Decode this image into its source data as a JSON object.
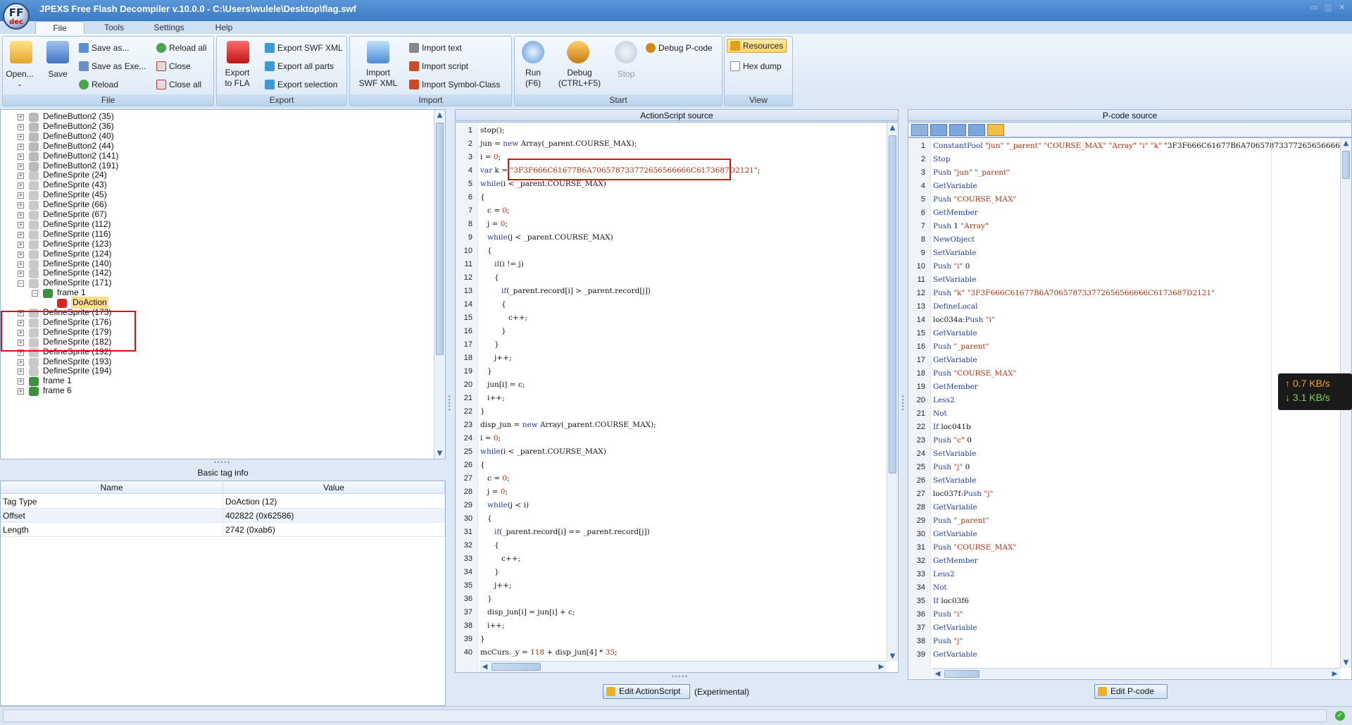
{
  "window": {
    "title": "JPEXS Free Flash Decompiler v.10.0.0 - C:\\Users\\wulele\\Desktop\\flag.swf",
    "logo_text": "FF",
    "logo_sub": "dec"
  },
  "menu": {
    "tabs": [
      "File",
      "Tools",
      "Settings",
      "Help"
    ],
    "active": "File"
  },
  "ribbon": {
    "file": {
      "title": "File",
      "open": "Open...",
      "save": "Save",
      "save_as": "Save as...",
      "save_as_exe": "Save as Exe...",
      "reload": "Reload",
      "reload_all": "Reload all",
      "close": "Close",
      "close_all": "Close all"
    },
    "export": {
      "title": "Export",
      "export_fla_l1": "Export",
      "export_fla_l2": "to FLA",
      "export_swf_xml": "Export SWF XML",
      "export_all_parts": "Export all parts",
      "export_selection": "Export selection"
    },
    "import": {
      "title": "Import",
      "import_swf_xml_l1": "Import",
      "import_swf_xml_l2": "SWF XML",
      "import_text": "Import text",
      "import_script": "Import script",
      "import_symbol_class": "Import Symbol-Class"
    },
    "start": {
      "title": "Start",
      "run_l1": "Run",
      "run_l2": "(F6)",
      "debug_l1": "Debug",
      "debug_l2": "(CTRL+F5)",
      "stop": "Stop",
      "debug_pcode": "Debug P-code"
    },
    "view": {
      "title": "View",
      "resources": "Resources",
      "hex_dump": "Hex dump"
    }
  },
  "tree": {
    "items": [
      {
        "label": "DefineButton2 (35)",
        "type": "button",
        "depth": 0
      },
      {
        "label": "DefineButton2 (36)",
        "type": "button",
        "depth": 0
      },
      {
        "label": "DefineButton2 (40)",
        "type": "button",
        "depth": 0
      },
      {
        "label": "DefineButton2 (44)",
        "type": "button",
        "depth": 0
      },
      {
        "label": "DefineButton2 (141)",
        "type": "button",
        "depth": 0
      },
      {
        "label": "DefineButton2 (191)",
        "type": "button",
        "depth": 0
      },
      {
        "label": "DefineSprite (24)",
        "type": "sprite",
        "depth": 0
      },
      {
        "label": "DefineSprite (43)",
        "type": "sprite",
        "depth": 0
      },
      {
        "label": "DefineSprite (45)",
        "type": "sprite",
        "depth": 0
      },
      {
        "label": "DefineSprite (66)",
        "type": "sprite",
        "depth": 0
      },
      {
        "label": "DefineSprite (67)",
        "type": "sprite",
        "depth": 0
      },
      {
        "label": "DefineSprite (112)",
        "type": "sprite",
        "depth": 0
      },
      {
        "label": "DefineSprite (116)",
        "type": "sprite",
        "depth": 0
      },
      {
        "label": "DefineSprite (123)",
        "type": "sprite",
        "depth": 0
      },
      {
        "label": "DefineSprite (124)",
        "type": "sprite",
        "depth": 0
      },
      {
        "label": "DefineSprite (140)",
        "type": "sprite",
        "depth": 0
      },
      {
        "label": "DefineSprite (142)",
        "type": "sprite",
        "depth": 0
      },
      {
        "label": "DefineSprite (171)",
        "type": "sprite",
        "depth": 0
      },
      {
        "label": "frame 1",
        "type": "frame",
        "depth": 1
      },
      {
        "label": "DoAction",
        "type": "action",
        "depth": 2
      },
      {
        "label": "DefineSprite (173)",
        "type": "sprite",
        "depth": 0
      },
      {
        "label": "DefineSprite (176)",
        "type": "sprite",
        "depth": 0
      },
      {
        "label": "DefineSprite (179)",
        "type": "sprite",
        "depth": 0
      },
      {
        "label": "DefineSprite (182)",
        "type": "sprite",
        "depth": 0
      },
      {
        "label": "DefineSprite (192)",
        "type": "sprite",
        "depth": 0
      },
      {
        "label": "DefineSprite (193)",
        "type": "sprite",
        "depth": 0
      },
      {
        "label": "DefineSprite (194)",
        "type": "sprite",
        "depth": 0
      },
      {
        "label": "frame 1",
        "type": "frame",
        "depth": 0
      },
      {
        "label": "frame 6",
        "type": "frame",
        "depth": 0
      }
    ]
  },
  "info": {
    "title": "Basic tag info",
    "col_name": "Name",
    "col_value": "Value",
    "rows": [
      {
        "name": "Tag Type",
        "value": "DoAction (12)"
      },
      {
        "name": "Offset",
        "value": "402822 (0x62586)"
      },
      {
        "name": "Length",
        "value": "2742 (0xab6)"
      }
    ]
  },
  "actionscript": {
    "title": "ActionScript source",
    "edit_button": "Edit ActionScript",
    "experimental": "(Experimental)",
    "lines": [
      "stop();",
      "jun = new Array(_parent.COURSE_MAX);",
      "i = 0;",
      "var k = \"3F3F666C61677B6A706578733772656566666C6173687D2121\";",
      "while(i < _parent.COURSE_MAX)",
      "{",
      "   c = 0;",
      "   j = 0;",
      "   while(j < _parent.COURSE_MAX)",
      "   {",
      "      if(i != j)",
      "      {",
      "         if(_parent.record[i] > _parent.record[j])",
      "         {",
      "            c++;",
      "         }",
      "      }",
      "      j++;",
      "   }",
      "   jun[i] = c;",
      "   i++;",
      "}",
      "disp_jun = new Array(_parent.COURSE_MAX);",
      "i = 0;",
      "while(i < _parent.COURSE_MAX)",
      "{",
      "   c = 0;",
      "   j = 0;",
      "   while(j < i)",
      "   {",
      "      if(_parent.record[i] == _parent.record[j])",
      "      {",
      "         c++;",
      "      }",
      "      j++;",
      "   }",
      "   disp_jun[i] = jun[i] + c;",
      "   i++;",
      "}",
      "mcCurs._y = 118 + disp_jun[4] * 35;"
    ]
  },
  "pcode": {
    "title": "P-code source",
    "edit_button": "Edit P-code",
    "lines": [
      "ConstantPool \"jun\" \"_parent\" \"COURSE_MAX\" \"Array\" \"i\" \"k\" \"3F3F666C61677B6A706578733772656566666C6",
      "Stop",
      "Push \"jun\" \"_parent\"",
      "GetVariable",
      "Push \"COURSE_MAX\"",
      "GetMember",
      "Push 1 \"Array\"",
      "NewObject",
      "SetVariable",
      "Push \"i\" 0",
      "SetVariable",
      "Push \"k\" \"3F3F666C61677B6A706578733772656566666C6173687D2121\"",
      "DefineLocal",
      "loc034a:Push \"i\"",
      "GetVariable",
      "Push \"_parent\"",
      "GetVariable",
      "Push \"COURSE_MAX\"",
      "GetMember",
      "Less2",
      "Not",
      "If loc041b",
      "Push \"c\" 0",
      "SetVariable",
      "Push \"j\" 0",
      "SetVariable",
      "loc037f:Push \"j\"",
      "GetVariable",
      "Push \"_parent\"",
      "GetVariable",
      "Push \"COURSE_MAX\"",
      "GetMember",
      "Less2",
      "Not",
      "If loc03f6",
      "Push \"i\"",
      "GetVariable",
      "Push \"j\"",
      "GetVariable"
    ],
    "toolbar_icons": [
      "align-icon",
      "onoff-push-icon",
      "goto-icon",
      "hex-icon",
      "settings-icon"
    ]
  },
  "network": {
    "up": "0.7 KB/s",
    "down": "3.1 KB/s",
    "up_arrow": "↑",
    "down_arrow": "↓"
  },
  "colors": {
    "accent": "#3c7bc4",
    "highlight_box": "#e01010",
    "selected_tree": "#ffe08a"
  }
}
